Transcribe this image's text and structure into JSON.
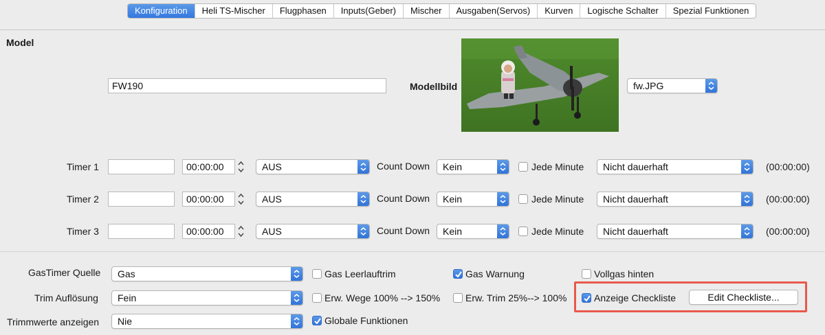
{
  "tabs": [
    {
      "label": "Konfiguration",
      "active": true
    },
    {
      "label": "Heli TS-Mischer"
    },
    {
      "label": "Flugphasen"
    },
    {
      "label": "Inputs(Geber)"
    },
    {
      "label": "Mischer"
    },
    {
      "label": "Ausgaben(Servos)"
    },
    {
      "label": "Kurven"
    },
    {
      "label": "Logische Schalter"
    },
    {
      "label": "Spezial Funktionen"
    }
  ],
  "model": {
    "section_label": "Model",
    "name_value": "FW190",
    "image_label": "Modellbild",
    "image_file": "fw.JPG"
  },
  "timers": [
    {
      "label": "Timer 1",
      "name_value": "",
      "time": "00:00:00",
      "mode": "AUS",
      "direction_label": "Count Down",
      "direction_value": "Kein",
      "minute_label": "Jede Minute",
      "minute_checked": false,
      "persist": "Nicht dauerhaft",
      "persist_value": "(00:00:00)"
    },
    {
      "label": "Timer 2",
      "name_value": "",
      "time": "00:00:00",
      "mode": "AUS",
      "direction_label": "Count Down",
      "direction_value": "Kein",
      "minute_label": "Jede Minute",
      "minute_checked": false,
      "persist": "Nicht dauerhaft",
      "persist_value": "(00:00:00)"
    },
    {
      "label": "Timer 3",
      "name_value": "",
      "time": "00:00:00",
      "mode": "AUS",
      "direction_label": "Count Down",
      "direction_value": "Kein",
      "minute_label": "Jede Minute",
      "minute_checked": false,
      "persist": "Nicht dauerhaft",
      "persist_value": "(00:00:00)"
    }
  ],
  "settings": {
    "gas_source_label": "GasTimer Quelle",
    "gas_source_value": "Gas",
    "trim_res_label": "Trim Auflösung",
    "trim_res_value": "Fein",
    "trim_show_label": "Trimmwerte anzeigen",
    "trim_show_value": "Nie",
    "gas_idle_trim": {
      "label": "Gas Leerlauftrim",
      "checked": false
    },
    "gas_warning": {
      "label": "Gas Warnung",
      "checked": true
    },
    "full_throttle_rear": {
      "label": "Vollgas hinten",
      "checked": false
    },
    "ext_limits": {
      "label": "Erw. Wege 100% --> 150%",
      "checked": false
    },
    "ext_trim": {
      "label": "Erw. Trim 25%--> 100%",
      "checked": false
    },
    "show_checklist": {
      "label": "Anzeige Checkliste",
      "checked": true
    },
    "edit_checklist_button": "Edit Checkliste...",
    "global_functions": {
      "label": "Globale Funktionen",
      "checked": true
    }
  },
  "colors": {
    "accent": "#3478e0",
    "highlight": "#e8594c",
    "background": "#ececec"
  },
  "icons": {
    "popup": "chevron-up-down-icon",
    "stepper": "stepper-icon",
    "check": "checkmark-icon"
  }
}
